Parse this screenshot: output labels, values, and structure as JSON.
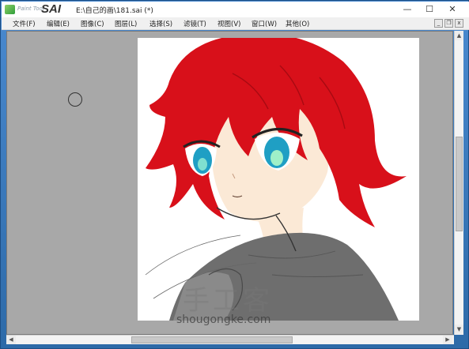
{
  "titlebar": {
    "logo_small": "Paint Tool",
    "logo_big": "SAI",
    "file_title": "E:\\自己的画\\181.sai (*)",
    "minimize": "—",
    "maximize": "☐",
    "close": "✕"
  },
  "menu": {
    "items": [
      {
        "label": "文件(F)"
      },
      {
        "label": "编辑(E)"
      },
      {
        "label": "图像(C)"
      },
      {
        "label": "图层(L)"
      },
      {
        "label": "选择(S)"
      },
      {
        "label": "滤镜(T)"
      },
      {
        "label": "视图(V)"
      },
      {
        "label": "窗口(W)"
      },
      {
        "label": "其他(O)"
      }
    ],
    "mdi_min": "_",
    "mdi_restore": "❐",
    "mdi_close": "x"
  },
  "scroll": {
    "up": "▲",
    "down": "▼",
    "left": "◀",
    "right": "▶"
  },
  "watermark": {
    "cn": "手工客",
    "url": "shougongke.com"
  },
  "colors": {
    "hair": "#d8101a",
    "skin": "#fbe9d6",
    "eye": "#1f9fc4",
    "cloth": "#6e6e6e",
    "canvas_bg": "#a8a8a8"
  }
}
